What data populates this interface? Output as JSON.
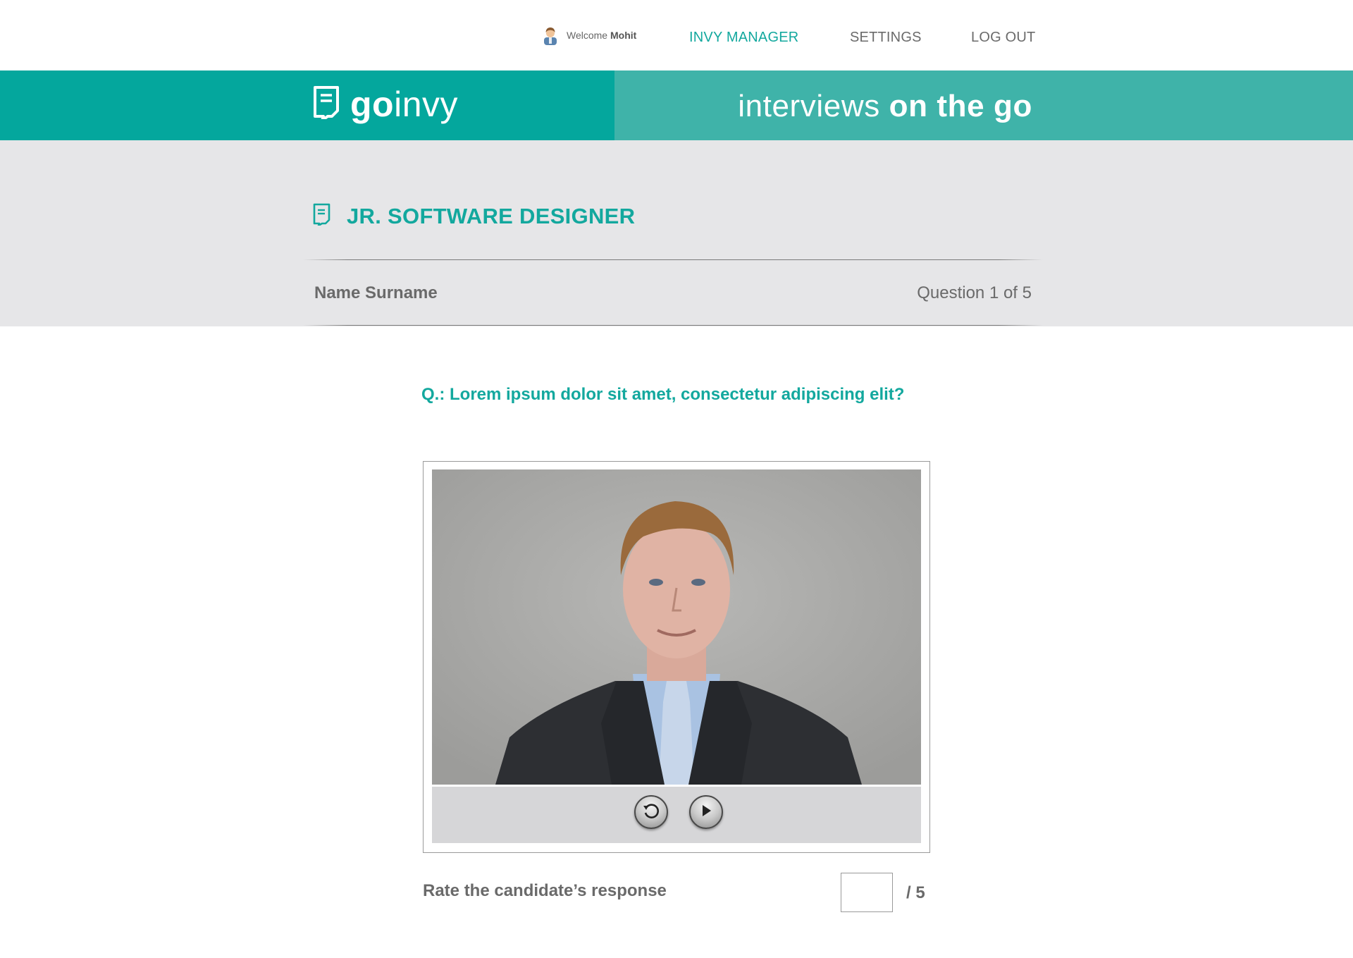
{
  "nav": {
    "welcome_prefix": "Welcome",
    "user_name": "Mohit",
    "links": [
      {
        "label": "INVY MANAGER",
        "active": true
      },
      {
        "label": "SETTINGS",
        "active": false
      },
      {
        "label": "LOG OUT",
        "active": false
      }
    ]
  },
  "banner": {
    "logo_bold": "go",
    "logo_light": "invy",
    "tagline_light": "interviews ",
    "tagline_bold": "on the go"
  },
  "interview": {
    "job_title": "JR. SOFTWARE DESIGNER",
    "candidate_name": "Name Surname",
    "question_count": "Question 1 of 5",
    "question": "Q.: Lorem ipsum dolor sit amet, consectetur adipiscing elit?"
  },
  "video": {
    "replay_icon": "replay-icon",
    "play_icon": "play-icon"
  },
  "rating": {
    "label": "Rate the candidate’s response",
    "value": "",
    "max_label": "/  5"
  },
  "colors": {
    "brand_teal": "#04a79d",
    "banner_light_teal": "#3fb3a9",
    "accent_text": "#13a89e",
    "grey_panel": "#e6e6e8"
  }
}
